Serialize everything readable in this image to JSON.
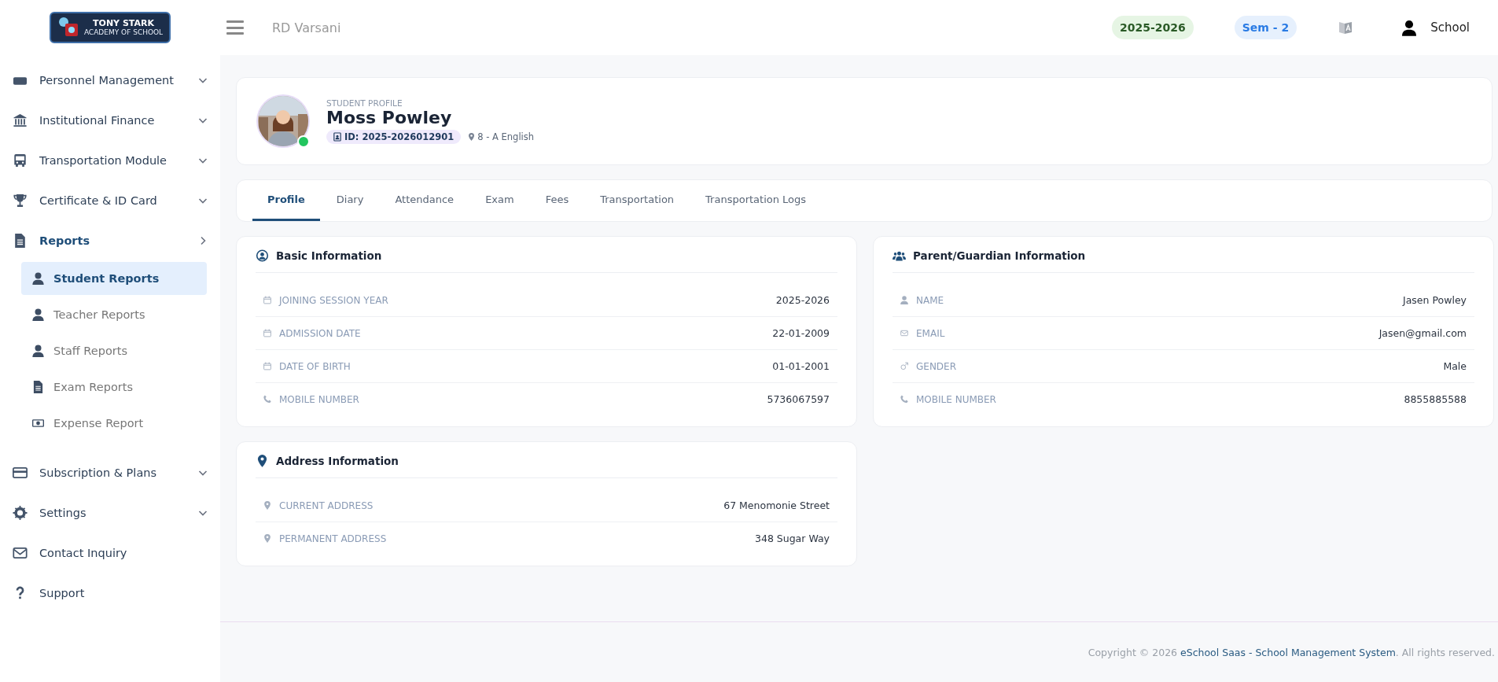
{
  "header": {
    "logo": {
      "line_1": "TONY STARK",
      "line_2": "ACADEMY OF SCHOOL"
    },
    "user_name": "RD Varsani",
    "session": "2025-2026",
    "semester": "Sem - 2",
    "account": "School"
  },
  "sidebar": {
    "items": [
      {
        "label": "Personnel Management",
        "kind": "group",
        "expanded": false
      },
      {
        "label": "Institutional Finance",
        "kind": "group",
        "expanded": false
      },
      {
        "label": "Transportation Module",
        "kind": "group",
        "expanded": false
      },
      {
        "label": "Certificate & ID Card",
        "kind": "group",
        "expanded": false
      },
      {
        "label": "Reports",
        "kind": "group",
        "expanded": true,
        "children": [
          {
            "label": "Student Reports",
            "selected": true
          },
          {
            "label": "Teacher Reports",
            "selected": false
          },
          {
            "label": "Staff Reports",
            "selected": false
          },
          {
            "label": "Exam Reports",
            "selected": false
          },
          {
            "label": "Expense Report",
            "selected": false
          }
        ]
      },
      {
        "label": "Subscription & Plans",
        "kind": "group",
        "expanded": false
      },
      {
        "label": "Settings",
        "kind": "group",
        "expanded": false
      },
      {
        "label": "Contact Inquiry",
        "kind": "link"
      },
      {
        "label": "Support",
        "kind": "link"
      }
    ]
  },
  "profile": {
    "caption": "STUDENT PROFILE",
    "name": "Moss Powley",
    "online": true,
    "student_id": "ID: 2025-2026012901",
    "class": "8 - A English"
  },
  "tabs": [
    {
      "label": "Profile",
      "selected": true
    },
    {
      "label": "Diary",
      "selected": false
    },
    {
      "label": "Attendance",
      "selected": false
    },
    {
      "label": "Exam",
      "selected": false
    },
    {
      "label": "Fees",
      "selected": false
    },
    {
      "label": "Transportation",
      "selected": false
    },
    {
      "label": "Transportation Logs",
      "selected": false
    }
  ],
  "cards": [
    {
      "title": "Basic Information",
      "rows": [
        {
          "label": "JOINING SESSION YEAR",
          "value": "2025-2026"
        },
        {
          "label": "ADMISSION DATE",
          "value": "22-01-2009"
        },
        {
          "label": "DATE OF BIRTH",
          "value": "01-01-2001"
        },
        {
          "label": "MOBILE NUMBER",
          "value": "5736067597"
        }
      ]
    },
    {
      "title": "Parent/Guardian Information",
      "rows": [
        {
          "label": "NAME",
          "value": "Jasen Powley"
        },
        {
          "label": "EMAIL",
          "value": "Jasen@gmail.com"
        },
        {
          "label": "GENDER",
          "value": "Male"
        },
        {
          "label": "MOBILE NUMBER",
          "value": "8855885588"
        }
      ]
    },
    {
      "title": "Address Information",
      "rows": [
        {
          "label": "CURRENT ADDRESS",
          "value": "67 Menomonie Street"
        },
        {
          "label": "PERMANENT ADDRESS",
          "value": "348 Sugar Way"
        }
      ]
    }
  ],
  "footer": {
    "before": "Copyright © 2026",
    "link": "eSchool Saas - School Management System",
    "after": ". All rights reserved."
  }
}
